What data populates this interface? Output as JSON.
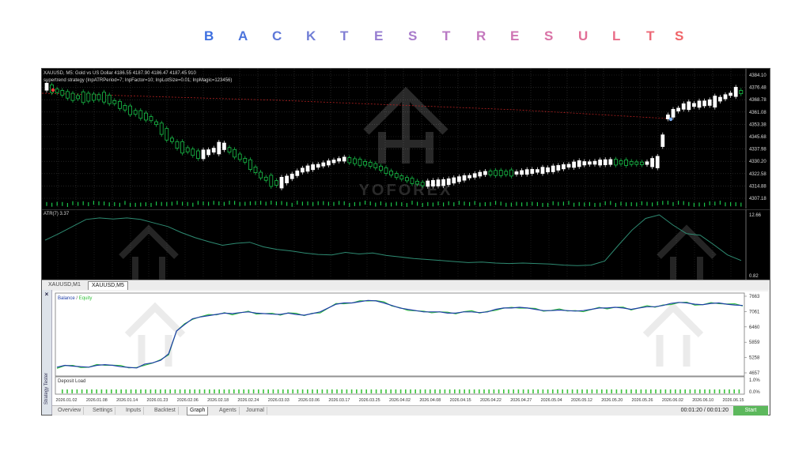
{
  "heading": {
    "letters": [
      "B",
      "A",
      "C",
      "K",
      "T",
      "E",
      "S",
      "T",
      "R",
      "E",
      "S",
      "U",
      "L",
      "T",
      "S"
    ],
    "colors": [
      "#3d6fe0",
      "#4c74dc",
      "#5e78d8",
      "#707ed6",
      "#827fd4",
      "#967dd0",
      "#a87bcb",
      "#b879c4",
      "#c477bd",
      "#cf74b3",
      "#d972a6",
      "#e26f97",
      "#e96c88",
      "#ed6977",
      "#f06468"
    ]
  },
  "price_chart": {
    "symbol_line": "XAUUSD, M5:  Gold vs US Dollar  4186.55 4187.90 4186.47 4187.45  910",
    "indicator_line": "supertrend strategy (InpATRPeriod=7; InpFactor=10; InpLotSize=0.01; InpMagic=123456)",
    "price_ticks": [
      "4384.10",
      "4376.48",
      "4368.78",
      "4361.08",
      "4353.38",
      "4345.68",
      "4337.98",
      "4330.20",
      "4322.58",
      "4314.88",
      "4307.18"
    ],
    "watermark": "YOFOREX",
    "bull_color": "#ffffff",
    "bear_color": "#19c34a",
    "stop_line_color": "#b22020"
  },
  "atr_chart": {
    "label": "ATR(7) 3.37",
    "ticks": [
      "12.66",
      "0.82"
    ],
    "line_color": "#2e8b72",
    "values": [
      7.5,
      8.8,
      10.2,
      11.6,
      11.9,
      11.7,
      11.9,
      11.6,
      10.9,
      10.2,
      9.0,
      8.0,
      7.2,
      6.5,
      6.9,
      7.1,
      6.2,
      5.7,
      5.4,
      5.0,
      4.7,
      4.6,
      5.1,
      4.8,
      5.0,
      4.5,
      4.2,
      3.9,
      3.7,
      3.5,
      3.3,
      3.1,
      3.2,
      3.0,
      2.9,
      3.0,
      2.9,
      2.8,
      2.6,
      2.5,
      2.6,
      3.4,
      6.5,
      9.5,
      11.8,
      12.5,
      10.5,
      8.8,
      8.5,
      6.6,
      4.6,
      3.5
    ]
  },
  "chart_tabs": [
    "XAUUSD,M1",
    "XAUUSD,M5"
  ],
  "strategy_tester": {
    "side_label": "Strategy Tester",
    "close_glyph": "×",
    "legend_balance": "Balance",
    "legend_sep": " / ",
    "legend_equity": "Equity",
    "balance_color": "#1f3fa8",
    "equity_color": "#34c23c",
    "y_ticks": [
      "7663",
      "7061",
      "6460",
      "5859",
      "5258",
      "4657"
    ],
    "deposit_load_label": "Deposit Load",
    "deposit_ticks": [
      "1.0%",
      "0.0%"
    ],
    "dates": [
      "2026.01.02",
      "2026.01.08",
      "2026.01.14",
      "2026.01.23",
      "2026.02.06",
      "2026.02.18",
      "2026.02.24",
      "2026.03.03",
      "2026.03.06",
      "2026.03.17",
      "2026.03.25",
      "2026.04.02",
      "2026.04.08",
      "2026.04.15",
      "2026.04.22",
      "2026.04.27",
      "2026.05.04",
      "2026.05.12",
      "2026.05.20",
      "2026.05.26",
      "2026.06.02",
      "2026.06.10",
      "2026.06.15"
    ],
    "balance_values": [
      4880,
      4950,
      4920,
      4900,
      4880,
      4950,
      4980,
      4950,
      4900,
      4870,
      4850,
      5000,
      5050,
      5150,
      5400,
      6300,
      6550,
      6780,
      6850,
      6900,
      6950,
      7000,
      6980,
      7020,
      7050,
      7000,
      6980,
      6960,
      6950,
      7000,
      6950,
      6920,
      6980,
      7050,
      7200,
      7350,
      7400,
      7400,
      7450,
      7500,
      7480,
      7400,
      7300,
      7200,
      7150,
      7100,
      7050,
      7050,
      7050,
      7000,
      7000,
      7050,
      7050,
      7020,
      7050,
      7150,
      7200,
      7200,
      7230,
      7200,
      7150,
      7100,
      7100,
      7120,
      7100,
      7080,
      7100,
      7150,
      7200,
      7200,
      7230,
      7200,
      7150,
      7200,
      7250,
      7250,
      7300,
      7380,
      7420,
      7400,
      7350,
      7330,
      7380,
      7400,
      7350,
      7320,
      7300
    ]
  },
  "bottom_tabs": [
    "Overview",
    "Settings",
    "Inputs",
    "Backtest",
    "Graph",
    "Agents",
    "Journal"
  ],
  "active_tab": "Graph",
  "timer": "00:01:20 / 00:01:20",
  "start_label": "Start"
}
